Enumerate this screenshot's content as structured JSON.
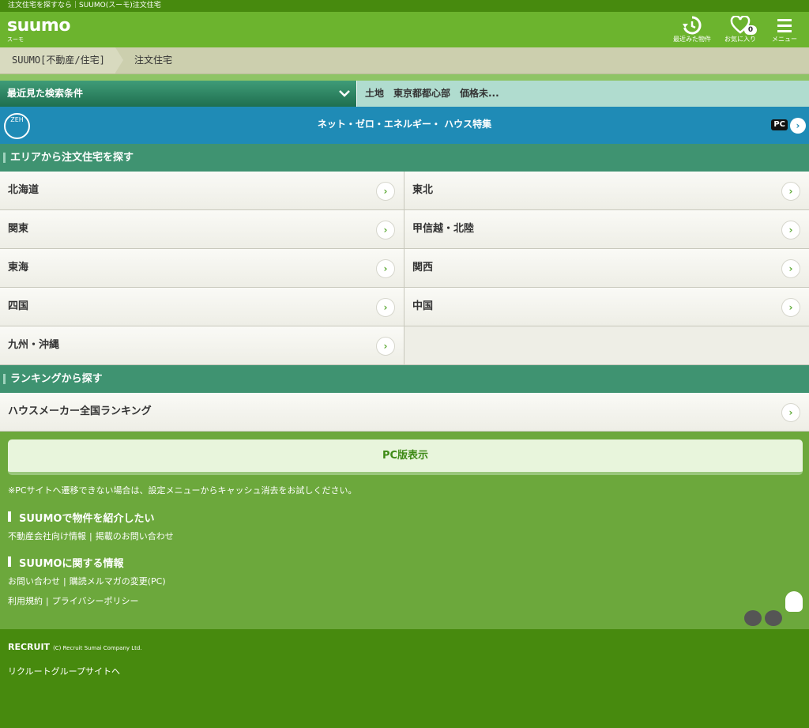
{
  "top_strip": {
    "text": "注文住宅を探すなら｜SUUMO(スーモ)注文住宅"
  },
  "header": {
    "logo": "suumo",
    "logo_sub": "スーモ",
    "recent_label": "最近みた物件",
    "favorites_label": "お気に入り",
    "favorites_count": "0",
    "menu_label": "メニュー"
  },
  "breadcrumb": {
    "items": [
      "SUUMO[不動産/住宅]",
      "注文住宅"
    ]
  },
  "recent_search": {
    "label": "最近見た検索条件",
    "value": "土地　東京都都心部　価格未..."
  },
  "banner": {
    "icon_text": "ZEH",
    "text": "ネット・ゼロ・エネルギー・ ハウス特集",
    "pc_badge": "PC"
  },
  "area": {
    "heading": "エリアから注文住宅を探す",
    "items": [
      "北海道",
      "東北",
      "関東",
      "甲信越・北陸",
      "東海",
      "関西",
      "四国",
      "中国",
      "九州・沖縄"
    ]
  },
  "ranking": {
    "heading": "ランキングから探す",
    "items": [
      "ハウスメーカー全国ランキング"
    ]
  },
  "footer": {
    "pc_button": "PC版表示",
    "note": "※PCサイトへ遷移できない場合は、設定メニューからキャッシュ消去をお試しください。",
    "section1_title": "SUUMOで物件を紹介したい",
    "section1_links": [
      "不動産会社向け情報",
      "掲載のお問い合わせ"
    ],
    "section2_title": "SUUMOに関する情報",
    "section2_links_row1": [
      "お問い合わせ",
      "購読メルマガの変更(PC)"
    ],
    "section2_links_row2": [
      "利用規約",
      "プライバシーポリシー"
    ],
    "separator": "|"
  },
  "bottom": {
    "recruit_logo": "RECRUIT",
    "copyright": "(C) Recruit Sumai Company Ltd.",
    "group_link": "リクルートグループサイトへ"
  }
}
